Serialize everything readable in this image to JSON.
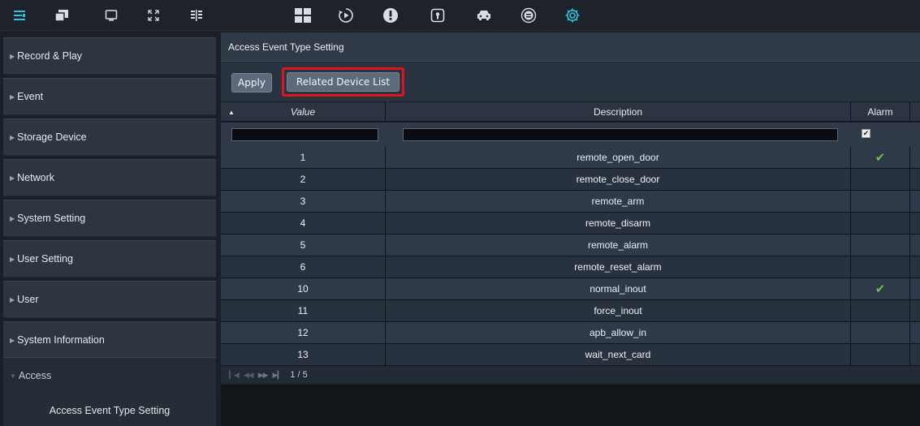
{
  "toolbar": {
    "left_icons": [
      "menu-icon",
      "window-tile-icon",
      "monitor-icon",
      "fullscreen-icon",
      "split-screen-icon"
    ],
    "center_icons": [
      "layout-grid-icon",
      "playback-icon",
      "alarm-icon",
      "access-control-icon",
      "vehicle-icon",
      "face-icon",
      "settings-icon"
    ]
  },
  "sidebar": {
    "items": [
      {
        "label": "Record & Play"
      },
      {
        "label": "Event"
      },
      {
        "label": "Storage Device"
      },
      {
        "label": "Network"
      },
      {
        "label": "System Setting"
      },
      {
        "label": "User Setting"
      },
      {
        "label": "User"
      },
      {
        "label": "System Information"
      },
      {
        "label": "Access"
      }
    ],
    "sub_item": "Access Event Type Setting"
  },
  "panel": {
    "title": "Access Event Type Setting",
    "apply_label": "Apply",
    "related_label": "Related Device List"
  },
  "table": {
    "headers": {
      "value": "Value",
      "description": "Description",
      "alarm": "Alarm"
    },
    "filter": {
      "value": "",
      "description": "",
      "alarm_checked": true
    },
    "rows": [
      {
        "value": "1",
        "description": "remote_open_door",
        "alarm": true
      },
      {
        "value": "2",
        "description": "remote_close_door",
        "alarm": false
      },
      {
        "value": "3",
        "description": "remote_arm",
        "alarm": false
      },
      {
        "value": "4",
        "description": "remote_disarm",
        "alarm": false
      },
      {
        "value": "5",
        "description": "remote_alarm",
        "alarm": false
      },
      {
        "value": "6",
        "description": "remote_reset_alarm",
        "alarm": false
      },
      {
        "value": "10",
        "description": "normal_inout",
        "alarm": true
      },
      {
        "value": "11",
        "description": "force_inout",
        "alarm": false
      },
      {
        "value": "12",
        "description": "apb_allow_in",
        "alarm": false
      },
      {
        "value": "13",
        "description": "wait_next_card",
        "alarm": false
      }
    ]
  },
  "pager": {
    "text": "1 / 5"
  },
  "colors": {
    "highlight": "#e0141e",
    "check": "#6ec04a",
    "accent_icon": "#2fc4e0"
  }
}
